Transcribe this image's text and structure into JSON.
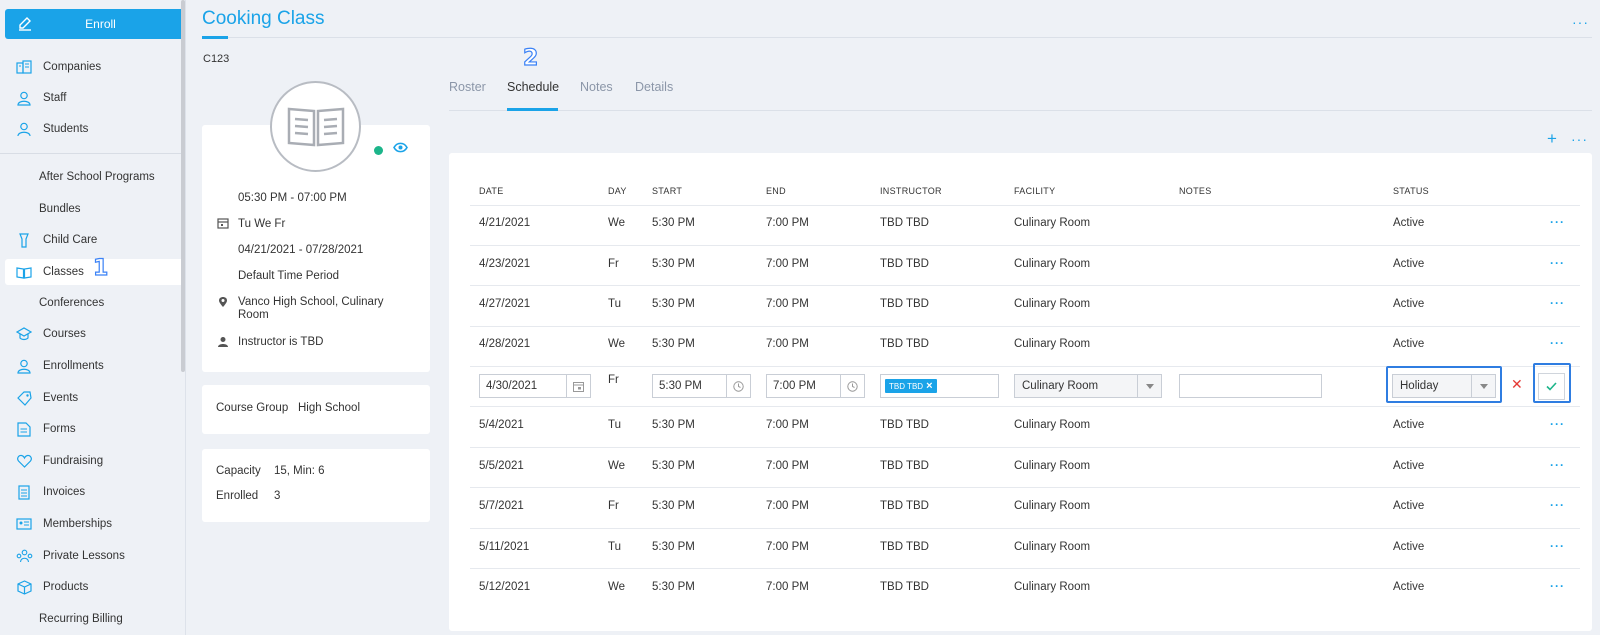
{
  "sidebar": {
    "enroll_label": "Enroll",
    "items": [
      {
        "label": "Companies",
        "icon": "companies-icon"
      },
      {
        "label": "Staff",
        "icon": "staff-icon"
      },
      {
        "label": "Students",
        "icon": "students-icon"
      },
      {
        "label": "After School Programs",
        "icon": ""
      },
      {
        "label": "Bundles",
        "icon": ""
      },
      {
        "label": "Child Care",
        "icon": "child-care-icon"
      },
      {
        "label": "Classes",
        "icon": "book-icon",
        "active": true
      },
      {
        "label": "Conferences",
        "icon": ""
      },
      {
        "label": "Courses",
        "icon": "graduation-cap-icon"
      },
      {
        "label": "Enrollments",
        "icon": "enrollments-icon"
      },
      {
        "label": "Events",
        "icon": "tag-icon"
      },
      {
        "label": "Forms",
        "icon": "form-icon"
      },
      {
        "label": "Fundraising",
        "icon": "heart-icon"
      },
      {
        "label": "Invoices",
        "icon": "invoice-icon"
      },
      {
        "label": "Memberships",
        "icon": "membership-card-icon"
      },
      {
        "label": "Private Lessons",
        "icon": "group-icon"
      },
      {
        "label": "Products",
        "icon": "box-icon"
      },
      {
        "label": "Recurring Billing",
        "icon": ""
      }
    ]
  },
  "markers": {
    "one": "1",
    "two": "2"
  },
  "header": {
    "title": "Cooking Class",
    "code": "C123",
    "more": "···"
  },
  "info": {
    "time": "05:30 PM - 07:00 PM",
    "days": "Tu We Fr",
    "dates": "04/21/2021 - 07/28/2021",
    "period": "Default Time Period",
    "location_line1": "Vanco High School, Culinary",
    "location_line2": "Room",
    "instructor": "Instructor is TBD",
    "course_group_label": "Course Group",
    "course_group_value": "High School",
    "capacity_label": "Capacity",
    "capacity_value": "15, Min: 6",
    "enrolled_label": "Enrolled",
    "enrolled_value": "3"
  },
  "tabs": [
    {
      "label": "Roster"
    },
    {
      "label": "Schedule",
      "active": true
    },
    {
      "label": "Notes"
    },
    {
      "label": "Details"
    }
  ],
  "table": {
    "add_label": "+",
    "more_label": "···",
    "headers": [
      "DATE",
      "DAY",
      "START",
      "END",
      "INSTRUCTOR",
      "FACILITY",
      "NOTES",
      "STATUS"
    ],
    "rows": [
      {
        "date": "4/21/2021",
        "day": "We",
        "start": "5:30 PM",
        "end": "7:00 PM",
        "instructor": "TBD TBD",
        "facility": "Culinary Room",
        "notes": "",
        "status": "Active"
      },
      {
        "date": "4/23/2021",
        "day": "Fr",
        "start": "5:30 PM",
        "end": "7:00 PM",
        "instructor": "TBD TBD",
        "facility": "Culinary Room",
        "notes": "",
        "status": "Active"
      },
      {
        "date": "4/27/2021",
        "day": "Tu",
        "start": "5:30 PM",
        "end": "7:00 PM",
        "instructor": "TBD TBD",
        "facility": "Culinary Room",
        "notes": "",
        "status": "Active"
      },
      {
        "date": "4/28/2021",
        "day": "We",
        "start": "5:30 PM",
        "end": "7:00 PM",
        "instructor": "TBD TBD",
        "facility": "Culinary Room",
        "notes": "",
        "status": "Active"
      },
      {
        "date": "5/4/2021",
        "day": "Tu",
        "start": "5:30 PM",
        "end": "7:00 PM",
        "instructor": "TBD TBD",
        "facility": "Culinary Room",
        "notes": "",
        "status": "Active"
      },
      {
        "date": "5/5/2021",
        "day": "We",
        "start": "5:30 PM",
        "end": "7:00 PM",
        "instructor": "TBD TBD",
        "facility": "Culinary Room",
        "notes": "",
        "status": "Active"
      },
      {
        "date": "5/7/2021",
        "day": "Fr",
        "start": "5:30 PM",
        "end": "7:00 PM",
        "instructor": "TBD TBD",
        "facility": "Culinary Room",
        "notes": "",
        "status": "Active"
      },
      {
        "date": "5/11/2021",
        "day": "Tu",
        "start": "5:30 PM",
        "end": "7:00 PM",
        "instructor": "TBD TBD",
        "facility": "Culinary Room",
        "notes": "",
        "status": "Active"
      },
      {
        "date": "5/12/2021",
        "day": "We",
        "start": "5:30 PM",
        "end": "7:00 PM",
        "instructor": "TBD TBD",
        "facility": "Culinary Room",
        "notes": "",
        "status": "Active"
      }
    ],
    "edit_row": {
      "date": "4/30/2021",
      "day": "Fr",
      "start": "5:30 PM",
      "end": "7:00 PM",
      "instructor_chip": "TBD TBD",
      "facility": "Culinary Room",
      "notes": "",
      "status": "Holiday"
    }
  },
  "colors": {
    "accent": "#1aa3e8",
    "active_dot": "#1cb58a",
    "cancel": "#e53935",
    "highlight": "#2f7de1"
  }
}
